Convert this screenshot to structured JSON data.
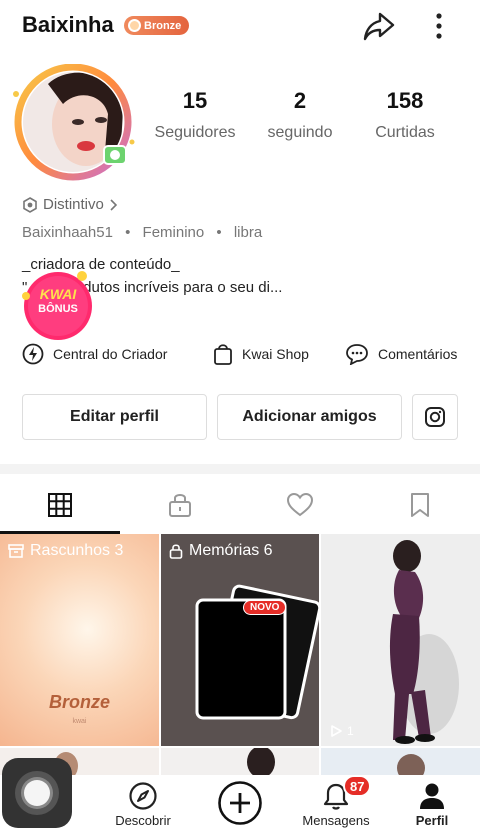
{
  "header": {
    "username": "Baixinha",
    "badge_label": "Bronze"
  },
  "stats": [
    {
      "value": "15",
      "label": "Seguidores"
    },
    {
      "value": "2",
      "label": "seguindo"
    },
    {
      "value": "158",
      "label": "Curtidas"
    }
  ],
  "profile": {
    "distintivo_label": "Distintivo",
    "handle": "Baixinhaah51",
    "gender": "Feminino",
    "sign": "libra",
    "separator": "•",
    "bio_line1": "_criadora de conteúdo_",
    "bio_line2": "\"        ntre produtos incríveis para o seu di...",
    "bonus_line1": "KWAI",
    "bonus_line2": "BÔNUS"
  },
  "shortcuts": [
    {
      "label": "Central do Criador",
      "icon": "lightning-icon"
    },
    {
      "label": "Kwai Shop",
      "icon": "shopping-bag-icon"
    },
    {
      "label": "Comentários",
      "icon": "chat-bubble-icon"
    }
  ],
  "buttons": {
    "edit_profile": "Editar perfil",
    "add_friends": "Adicionar amigos"
  },
  "tabs": [
    {
      "name": "grid",
      "icon": "grid-icon",
      "active": true
    },
    {
      "name": "private",
      "icon": "lock-icon",
      "active": false
    },
    {
      "name": "liked",
      "icon": "heart-icon",
      "active": false
    },
    {
      "name": "saved",
      "icon": "bookmark-icon",
      "active": false
    }
  ],
  "grid": {
    "drafts_label": "Rascunhos 3",
    "memories_label": "Memórias 6",
    "bronze_label": "Bronze",
    "bronze_sub": "kwai",
    "novo_label": "NOVO",
    "views": "1"
  },
  "bottom_nav": {
    "discover": "Descobrir",
    "messages": "Mensagens",
    "messages_badge": "87",
    "profile": "Perfil"
  },
  "colors": {
    "accent_red": "#e52d27",
    "badge_orange": "#e4643e",
    "tab_active": "#111111"
  }
}
